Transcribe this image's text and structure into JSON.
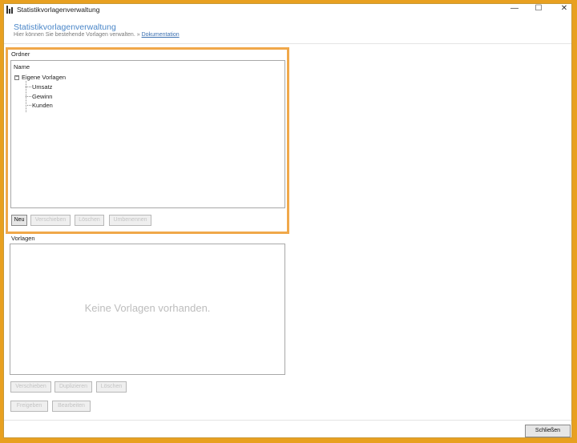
{
  "window": {
    "title": "Statistikvorlagenverwaltung",
    "controls": {
      "minimize": "—",
      "maximize": "☐",
      "close": "✕"
    }
  },
  "header": {
    "title": "Statistikvorlagenverwaltung",
    "description": "Hier können Sie bestehende Vorlagen verwalten. »",
    "doc_link": "Dokumentation"
  },
  "ordner": {
    "label": "Ordner",
    "column_header": "Name",
    "root": {
      "expander": "−",
      "label": "Eigene Vorlagen"
    },
    "children": [
      "Umsatz",
      "Gewinn",
      "Kunden"
    ],
    "buttons": {
      "new": "Neu",
      "move": "Verschieben",
      "delete": "Löschen",
      "rename": "Umbenennen"
    }
  },
  "vorlagen": {
    "label": "Vorlagen",
    "empty_message": "Keine Vorlagen vorhanden.",
    "buttons": {
      "move": "Verschieben",
      "duplicate": "Duplizieren",
      "delete": "Löschen",
      "release": "Freigeben",
      "edit": "Bearbeiten"
    }
  },
  "footer": {
    "close": "Schließen"
  },
  "colors": {
    "highlight": "#f0a84a",
    "header_title": "#4a86c8",
    "link": "#3a6fb0",
    "outer_frame": "#e8a020"
  }
}
